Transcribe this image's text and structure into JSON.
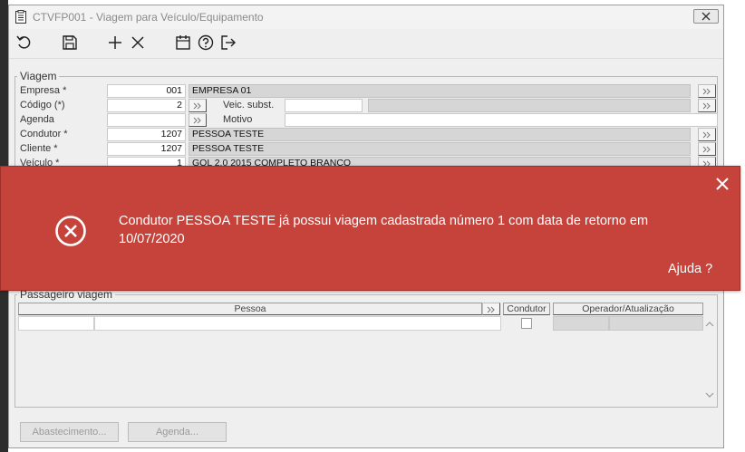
{
  "window": {
    "title": "CTVFP001 - Viagem para Veículo/Equipamento",
    "close_glyph": "x"
  },
  "toolbar": {
    "icons": [
      "undo-icon",
      "save-icon",
      "add-icon",
      "delete-icon",
      "calendar-icon",
      "help-icon",
      "exit-icon"
    ]
  },
  "viagem": {
    "title": "Viagem",
    "empresa": {
      "label": "Empresa *",
      "code": "001",
      "name": "EMPRESA 01"
    },
    "codigo": {
      "label": "Código (*)",
      "value": "2"
    },
    "veic_subst": {
      "label": "Veic. subst.",
      "value": ""
    },
    "agenda": {
      "label": "Agenda",
      "value": ""
    },
    "motivo": {
      "label": "Motivo",
      "value": ""
    },
    "condutor": {
      "label": "Condutor *",
      "code": "1207",
      "name": "PESSOA TESTE"
    },
    "cliente": {
      "label": "Cliente *",
      "code": "1207",
      "name": "PESSOA TESTE"
    },
    "veiculo": {
      "label": "Veículo *",
      "code": "1",
      "name": "GOL 2.0 2015 COMPLETO BRANCO"
    }
  },
  "passageiro": {
    "title": "Passageiro viagem",
    "columns": {
      "pessoa": "Pessoa",
      "condutor": "Condutor",
      "operador": "Operador/Atualização"
    }
  },
  "buttons": {
    "abastecimento": "Abastecimento...",
    "agenda": "Agenda..."
  },
  "alert": {
    "message": "Condutor PESSOA TESTE já possui viagem cadastrada número 1 com data de retorno em 10/07/2020",
    "help": "Ajuda ?",
    "color": "#c6433b"
  }
}
